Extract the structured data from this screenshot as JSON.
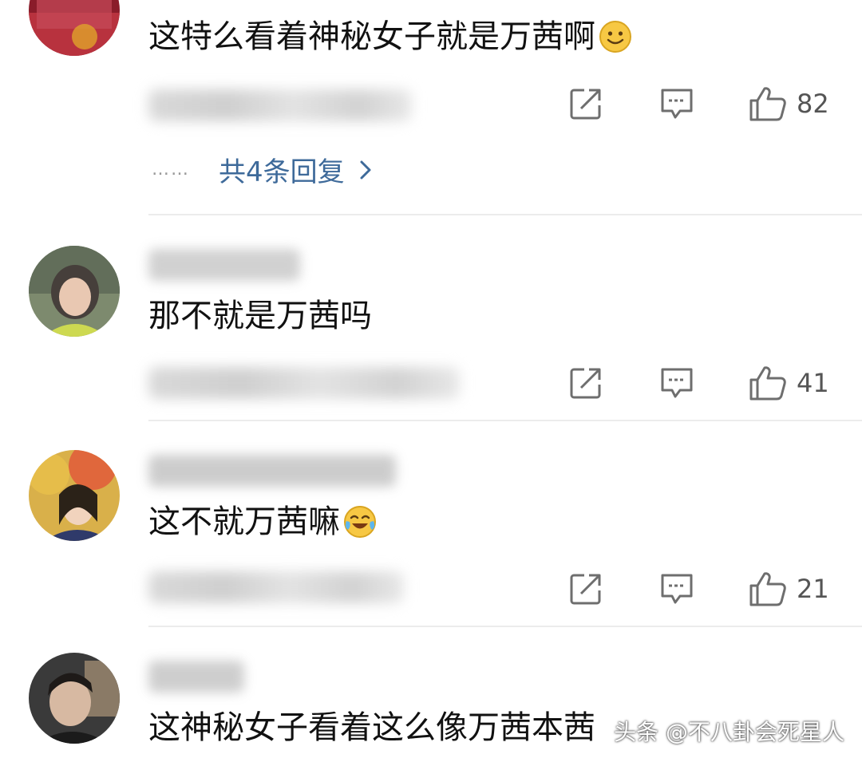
{
  "comments": [
    {
      "text": "这特么看着神秘女子就是万茜啊",
      "emoji": "smile-emoji",
      "likes": "82",
      "replies_link": "共4条回复",
      "replies_dots": "……"
    },
    {
      "text": "那不就是万茜吗",
      "likes": "41"
    },
    {
      "text": "这不就万茜嘛",
      "emoji": "laugh-cry-emoji",
      "likes": "21"
    },
    {
      "text": "这神秘女子看着这么像万茜本茜"
    }
  ],
  "icons": {
    "share": "share-icon",
    "comment": "comment-icon",
    "like": "thumbs-up-icon",
    "chevron": "chevron-right-icon"
  },
  "colors": {
    "link": "#3e6a9a",
    "icon": "#6e6e6e",
    "divider": "#ececec"
  },
  "watermark": "头条 @不八卦会死星人"
}
